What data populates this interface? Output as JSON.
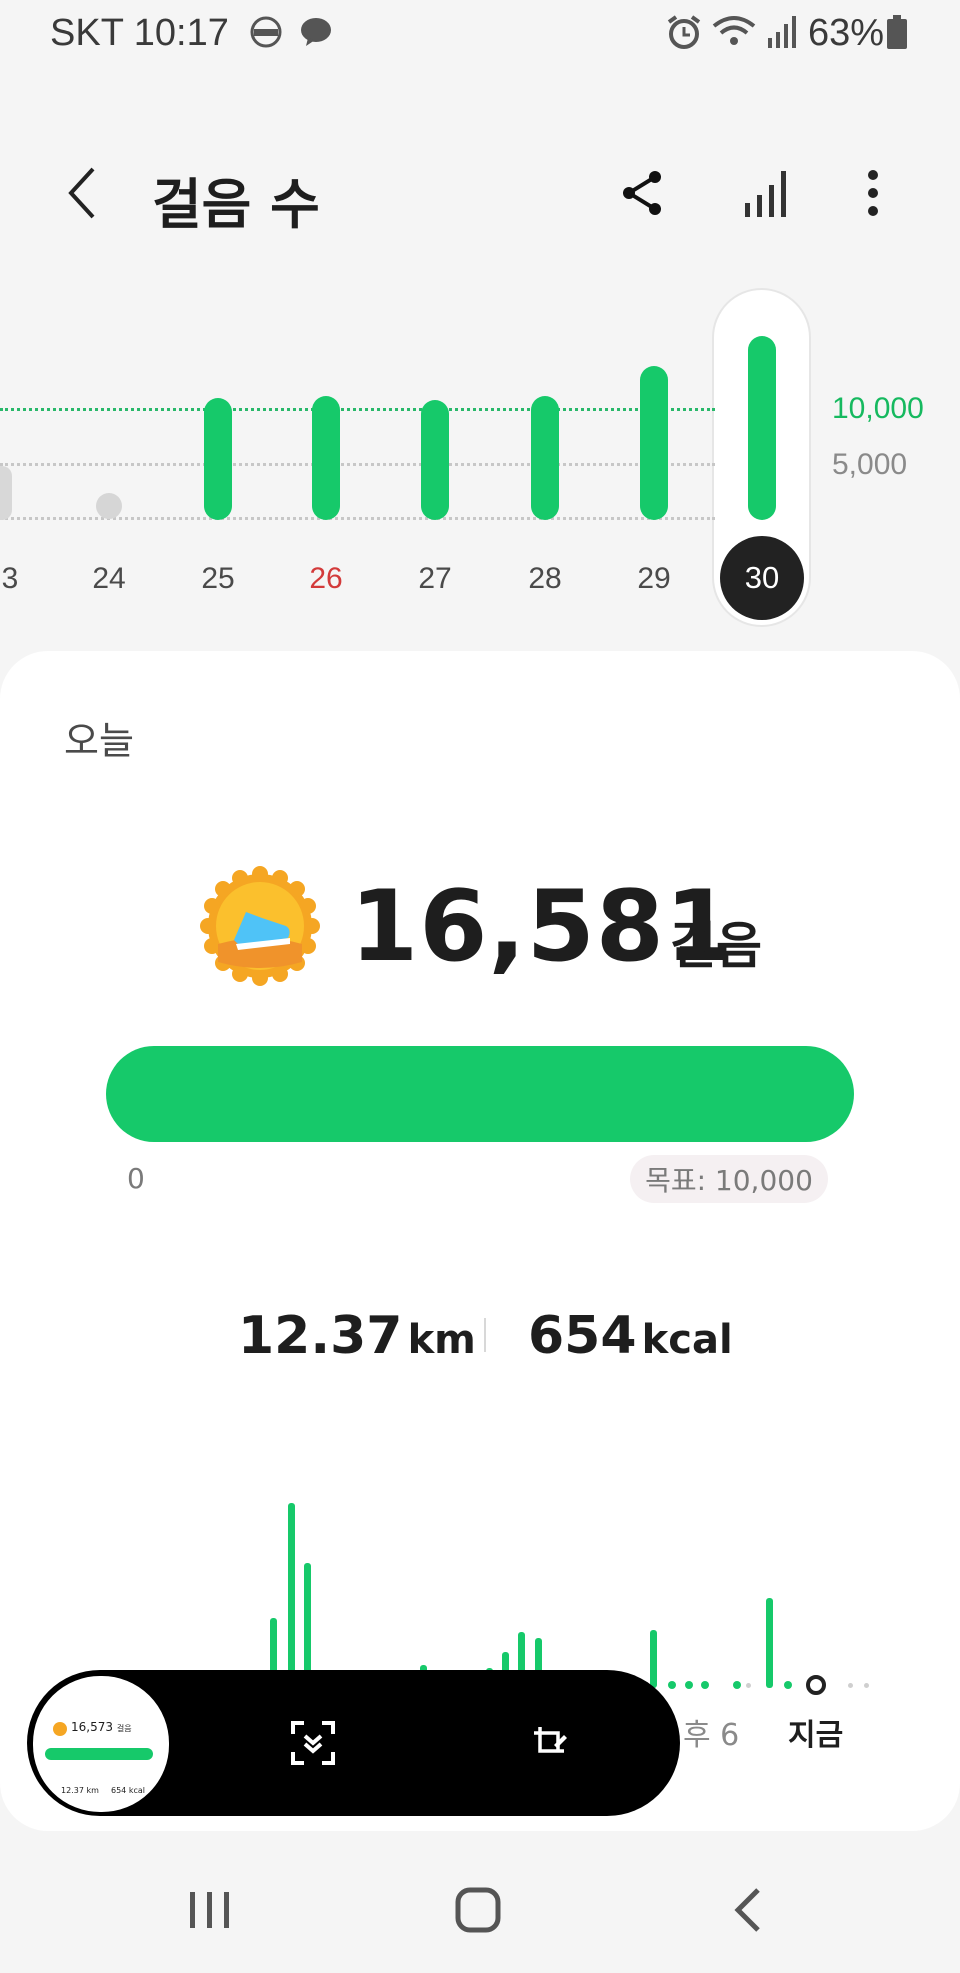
{
  "status_bar": {
    "carrier_time": "SKT 10:17",
    "battery": "63%"
  },
  "header": {
    "title": "걸음 수"
  },
  "week_chart": {
    "goal_label": "10,000",
    "mid_label": "5,000",
    "days": [
      "3",
      "24",
      "25",
      "26",
      "27",
      "28",
      "29",
      "30"
    ],
    "selected_day": "30",
    "colors": {
      "bar": "#16c96a",
      "weekend_label": "#d33a3a"
    }
  },
  "today": {
    "section_label": "오늘",
    "steps": "16,581",
    "steps_unit": "걸음",
    "progress_fraction": 1.0,
    "progress_start": "0",
    "goal_text": "목표: 10,000",
    "distance": "12.37",
    "distance_unit": "km",
    "calories": "654",
    "calories_unit": "kcal",
    "timeline_label_partial": "후 6",
    "timeline_now": "지금"
  },
  "overlay_toolbar": {
    "thumb_steps": "16,573",
    "thumb_unit": "걸음",
    "thumb_distance": "12.37 km",
    "thumb_calories": "654 kcal"
  }
}
